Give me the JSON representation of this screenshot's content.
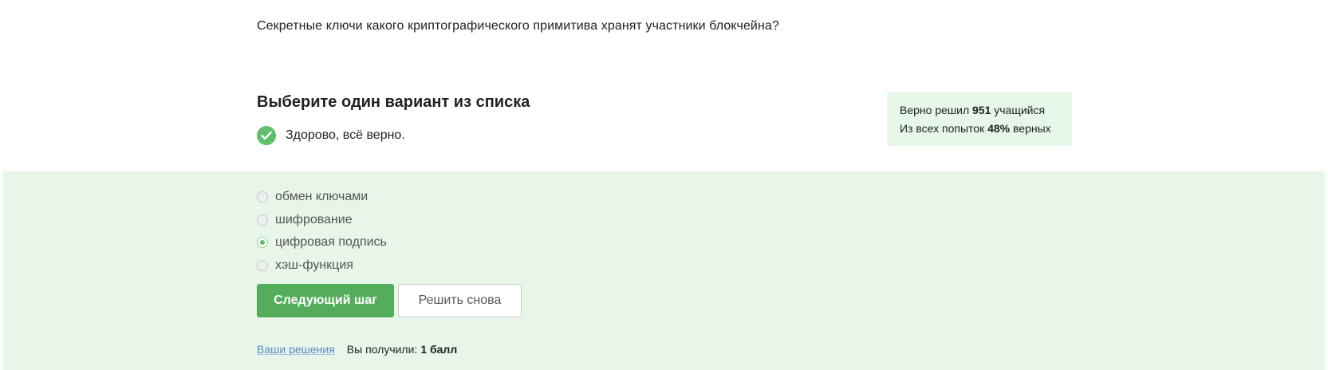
{
  "question": {
    "text": "Секретные ключи какого криптографического примитива хранят участники блокчейна?"
  },
  "quiz": {
    "instruction": "Выберите один вариант из списка",
    "status_text": "Здорово, всё верно.",
    "status_icon": "checkmark-circle-icon",
    "options": [
      {
        "label": "обмен ключами",
        "selected": false
      },
      {
        "label": "шифрование",
        "selected": false
      },
      {
        "label": "цифровая подпись",
        "selected": true
      },
      {
        "label": "хэш-функция",
        "selected": false
      }
    ]
  },
  "stats": {
    "solved_prefix": "Верно решил",
    "solved_count": "951",
    "solved_suffix": "учащийся",
    "attempts_prefix": "Из всех попыток",
    "attempts_percent": "48%",
    "attempts_suffix": "верных"
  },
  "actions": {
    "next_label": "Следующий шаг",
    "retry_label": "Решить снова"
  },
  "footer": {
    "solutions_link": "Ваши решения",
    "score_label": "Вы получили:",
    "score_value": "1 балл"
  },
  "colors": {
    "accent_green": "#54ad5a",
    "panel_background": "#e7f6e8",
    "stats_background": "#e6f6e9",
    "link_blue": "#5a88c8"
  }
}
